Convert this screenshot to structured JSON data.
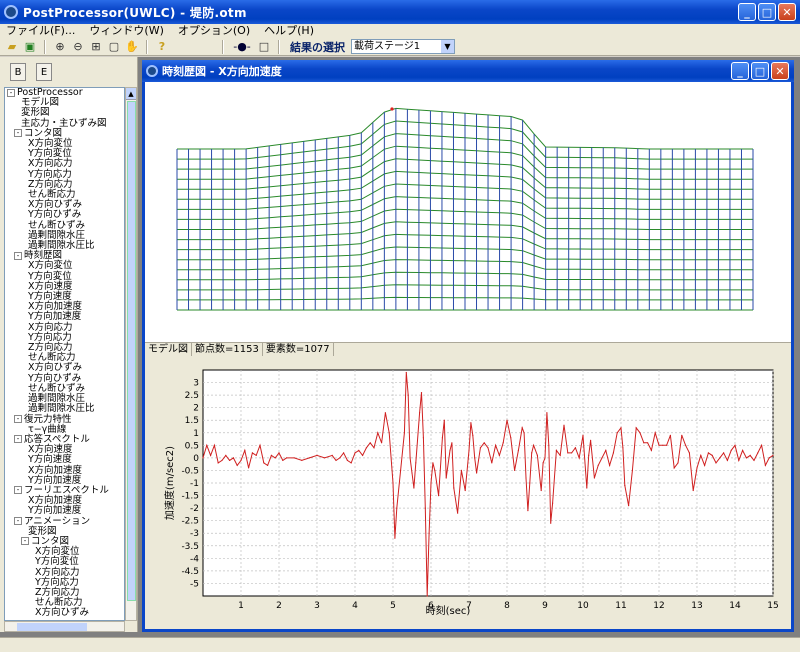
{
  "app": {
    "title": "PostProcessor(UWLC) - 堤防.otm"
  },
  "menu": [
    "ファイル(F)...",
    "ウィンドウ(W)",
    "オプション(O)",
    "ヘルプ(H)"
  ],
  "toolbar": {
    "select_label": "結果の選択",
    "combo_value": "載荷ステージ1"
  },
  "tree": [
    {
      "label": "PostProcessor",
      "level": 0,
      "exp": "-"
    },
    {
      "label": "モデル図",
      "level": 2
    },
    {
      "label": "変形図",
      "level": 2
    },
    {
      "label": "主応力・主ひずみ図",
      "level": 2
    },
    {
      "label": "コンタ図",
      "level": 1,
      "exp": "-"
    },
    {
      "label": "X方向変位",
      "level": 3
    },
    {
      "label": "Y方向変位",
      "level": 3
    },
    {
      "label": "X方向応力",
      "level": 3
    },
    {
      "label": "Y方向応力",
      "level": 3
    },
    {
      "label": "Z方向応力",
      "level": 3
    },
    {
      "label": "せん断応力",
      "level": 3
    },
    {
      "label": "X方向ひずみ",
      "level": 3
    },
    {
      "label": "Y方向ひずみ",
      "level": 3
    },
    {
      "label": "せん断ひずみ",
      "level": 3
    },
    {
      "label": "過剰間隙水圧",
      "level": 3
    },
    {
      "label": "過剰間隙水圧比",
      "level": 3
    },
    {
      "label": "時刻歴図",
      "level": 1,
      "exp": "-"
    },
    {
      "label": "X方向変位",
      "level": 3
    },
    {
      "label": "Y方向変位",
      "level": 3
    },
    {
      "label": "X方向速度",
      "level": 3
    },
    {
      "label": "Y方向速度",
      "level": 3
    },
    {
      "label": "X方向加速度",
      "level": 3
    },
    {
      "label": "Y方向加速度",
      "level": 3
    },
    {
      "label": "X方向応力",
      "level": 3
    },
    {
      "label": "Y方向応力",
      "level": 3
    },
    {
      "label": "Z方向応力",
      "level": 3
    },
    {
      "label": "せん断応力",
      "level": 3
    },
    {
      "label": "X方向ひずみ",
      "level": 3
    },
    {
      "label": "Y方向ひずみ",
      "level": 3
    },
    {
      "label": "せん断ひずみ",
      "level": 3
    },
    {
      "label": "過剰間隙水圧",
      "level": 3
    },
    {
      "label": "過剰間隙水圧比",
      "level": 3
    },
    {
      "label": "復元力特性",
      "level": 1,
      "exp": "-"
    },
    {
      "label": "τ−γ曲線",
      "level": 3
    },
    {
      "label": "応答スペクトル",
      "level": 1,
      "exp": "-"
    },
    {
      "label": "X方向速度",
      "level": 3
    },
    {
      "label": "Y方向速度",
      "level": 3
    },
    {
      "label": "X方向加速度",
      "level": 3
    },
    {
      "label": "Y方向加速度",
      "level": 3
    },
    {
      "label": "フーリエスペクトル",
      "level": 1,
      "exp": "-"
    },
    {
      "label": "X方向加速度",
      "level": 3
    },
    {
      "label": "Y方向加速度",
      "level": 3
    },
    {
      "label": "アニメーション",
      "level": 1,
      "exp": "-"
    },
    {
      "label": "変形図",
      "level": 3
    },
    {
      "label": "コンタ図",
      "level": 2,
      "exp": "-"
    },
    {
      "label": "X方向変位",
      "level": 4
    },
    {
      "label": "Y方向変位",
      "level": 4
    },
    {
      "label": "X方向応力",
      "level": 4
    },
    {
      "label": "Y方向応力",
      "level": 4
    },
    {
      "label": "Z方向応力",
      "level": 4
    },
    {
      "label": "せん断応力",
      "level": 4
    },
    {
      "label": "X方向ひずみ",
      "level": 4
    }
  ],
  "child": {
    "title": "時刻歴図 - X方向加速度"
  },
  "status": {
    "mode": "モデル図",
    "nodes": "節点数=1153",
    "elements": "要素数=1077"
  },
  "chart_data": {
    "type": "line",
    "xlabel": "時刻(sec)",
    "ylabel": "加速度(m/sec2)",
    "xlim": [
      0,
      15
    ],
    "ylim": [
      -5.5,
      3.5
    ],
    "xticks": [
      1,
      2,
      3,
      4,
      5,
      6,
      7,
      8,
      9,
      10,
      11,
      12,
      13,
      14,
      15
    ],
    "yticks": [
      3,
      2.5,
      2,
      1.5,
      1,
      0.5,
      0,
      -0.5,
      -1,
      -1.5,
      -2,
      -2.5,
      -3,
      -3.5,
      -4,
      -4.5,
      -5
    ],
    "grid": true,
    "series": [
      {
        "color": "#d02020",
        "points": [
          [
            0,
            0.0
          ],
          [
            0.1,
            0.5
          ],
          [
            0.2,
            0.1
          ],
          [
            0.3,
            0.5
          ],
          [
            0.4,
            -0.2
          ],
          [
            0.5,
            -0.1
          ],
          [
            0.6,
            0.1
          ],
          [
            0.7,
            -0.1
          ],
          [
            0.8,
            0.0
          ],
          [
            0.9,
            -0.3
          ],
          [
            1.0,
            -0.1
          ],
          [
            1.1,
            0.3
          ],
          [
            1.2,
            -0.4
          ],
          [
            1.3,
            0.2
          ],
          [
            1.4,
            0.1
          ],
          [
            1.5,
            0.5
          ],
          [
            1.6,
            -0.2
          ],
          [
            1.7,
            -0.3
          ],
          [
            1.8,
            0.1
          ],
          [
            1.9,
            0.0
          ],
          [
            2.0,
            0.2
          ],
          [
            2.1,
            -0.1
          ],
          [
            2.2,
            0.0
          ],
          [
            2.4,
            0.0
          ],
          [
            2.6,
            -0.1
          ],
          [
            2.8,
            0.0
          ],
          [
            3.0,
            0.1
          ],
          [
            3.2,
            0.0
          ],
          [
            3.4,
            0.1
          ],
          [
            3.5,
            -0.1
          ],
          [
            3.6,
            0.0
          ],
          [
            3.7,
            0.2
          ],
          [
            3.8,
            -0.1
          ],
          [
            3.9,
            -0.2
          ],
          [
            4.0,
            0.2
          ],
          [
            4.1,
            0.3
          ],
          [
            4.2,
            0.1
          ],
          [
            4.3,
            0.4
          ],
          [
            4.4,
            0.6
          ],
          [
            4.5,
            0.4
          ],
          [
            4.6,
            1.0
          ],
          [
            4.7,
            0.6
          ],
          [
            4.8,
            1.8
          ],
          [
            4.9,
            1.0
          ],
          [
            5.0,
            -1.0
          ],
          [
            5.05,
            -3.2
          ],
          [
            5.1,
            -2.0
          ],
          [
            5.2,
            -0.5
          ],
          [
            5.3,
            1.0
          ],
          [
            5.35,
            3.4
          ],
          [
            5.4,
            2.5
          ],
          [
            5.45,
            0.0
          ],
          [
            5.5,
            -0.6
          ],
          [
            5.55,
            -1.2
          ],
          [
            5.6,
            -0.2
          ],
          [
            5.7,
            1.8
          ],
          [
            5.75,
            2.6
          ],
          [
            5.8,
            0.8
          ],
          [
            5.85,
            -2.0
          ],
          [
            5.9,
            -5.5
          ],
          [
            5.95,
            -3.0
          ],
          [
            6.0,
            -1.0
          ],
          [
            6.05,
            -0.2
          ],
          [
            6.1,
            -0.5
          ],
          [
            6.2,
            -1.5
          ],
          [
            6.3,
            0.8
          ],
          [
            6.35,
            1.5
          ],
          [
            6.4,
            -0.8
          ],
          [
            6.5,
            0.3
          ],
          [
            6.55,
            0.6
          ],
          [
            6.6,
            -1.2
          ],
          [
            6.7,
            -2.2
          ],
          [
            6.8,
            -0.5
          ],
          [
            6.9,
            -1.3
          ],
          [
            7.0,
            0.3
          ],
          [
            7.05,
            1.4
          ],
          [
            7.1,
            0.9
          ],
          [
            7.15,
            0.0
          ],
          [
            7.2,
            -0.6
          ],
          [
            7.3,
            0.4
          ],
          [
            7.4,
            0.6
          ],
          [
            7.5,
            0.4
          ],
          [
            7.6,
            -0.2
          ],
          [
            7.7,
            0.5
          ],
          [
            7.8,
            0.1
          ],
          [
            7.9,
            0.6
          ],
          [
            8.0,
            1.5
          ],
          [
            8.1,
            0.8
          ],
          [
            8.2,
            -0.5
          ],
          [
            8.3,
            0.3
          ],
          [
            8.4,
            1.2
          ],
          [
            8.45,
            1.0
          ],
          [
            8.5,
            -0.8
          ],
          [
            8.55,
            -2.1
          ],
          [
            8.6,
            -1.0
          ],
          [
            8.65,
            0.2
          ],
          [
            8.7,
            0.5
          ],
          [
            8.8,
            0.1
          ],
          [
            8.9,
            -1.3
          ],
          [
            8.95,
            -0.2
          ],
          [
            9.0,
            0.0
          ],
          [
            9.05,
            1.8
          ],
          [
            9.1,
            0.5
          ],
          [
            9.15,
            -2.6
          ],
          [
            9.2,
            -1.8
          ],
          [
            9.3,
            0.3
          ],
          [
            9.4,
            0.1
          ],
          [
            9.5,
            1.3
          ],
          [
            9.6,
            0.2
          ],
          [
            9.7,
            0.2
          ],
          [
            9.8,
            0.4
          ],
          [
            9.9,
            0.0
          ],
          [
            10.0,
            0.9
          ],
          [
            10.1,
            -1.2
          ],
          [
            10.15,
            0.1
          ],
          [
            10.2,
            0.7
          ],
          [
            10.3,
            -0.8
          ],
          [
            10.4,
            -0.3
          ],
          [
            10.5,
            0.0
          ],
          [
            10.6,
            0.3
          ],
          [
            10.7,
            -0.3
          ],
          [
            10.8,
            0.2
          ],
          [
            10.9,
            1.0
          ],
          [
            11.0,
            1.2
          ],
          [
            11.05,
            0.4
          ],
          [
            11.1,
            -1.1
          ],
          [
            11.2,
            -1.9
          ],
          [
            11.3,
            -0.5
          ],
          [
            11.4,
            1.2
          ],
          [
            11.5,
            1.0
          ],
          [
            11.6,
            0.6
          ],
          [
            11.7,
            0.6
          ],
          [
            11.8,
            0.3
          ],
          [
            11.9,
            1.0
          ],
          [
            12.0,
            0.5
          ],
          [
            12.1,
            0.5
          ],
          [
            12.2,
            0.5
          ],
          [
            12.3,
            0.9
          ],
          [
            12.4,
            -0.4
          ],
          [
            12.5,
            -0.2
          ],
          [
            12.6,
            0.9
          ],
          [
            12.7,
            0.5
          ],
          [
            12.8,
            0.2
          ],
          [
            12.9,
            -1.3
          ],
          [
            13.0,
            -0.4
          ],
          [
            13.1,
            0.1
          ],
          [
            13.2,
            -0.3
          ],
          [
            13.3,
            0.2
          ],
          [
            13.4,
            0.1
          ],
          [
            13.5,
            -0.2
          ],
          [
            13.6,
            0.0
          ],
          [
            13.7,
            0.2
          ],
          [
            13.8,
            -0.1
          ],
          [
            13.9,
            0.3
          ],
          [
            14.0,
            0.5
          ],
          [
            14.1,
            -0.1
          ],
          [
            14.2,
            0.3
          ],
          [
            14.3,
            0.0
          ],
          [
            14.4,
            0.1
          ],
          [
            14.5,
            -0.1
          ],
          [
            14.6,
            0.2
          ],
          [
            14.7,
            0.5
          ],
          [
            14.8,
            -0.3
          ],
          [
            14.9,
            0.0
          ],
          [
            15.0,
            0.1
          ]
        ]
      }
    ]
  }
}
